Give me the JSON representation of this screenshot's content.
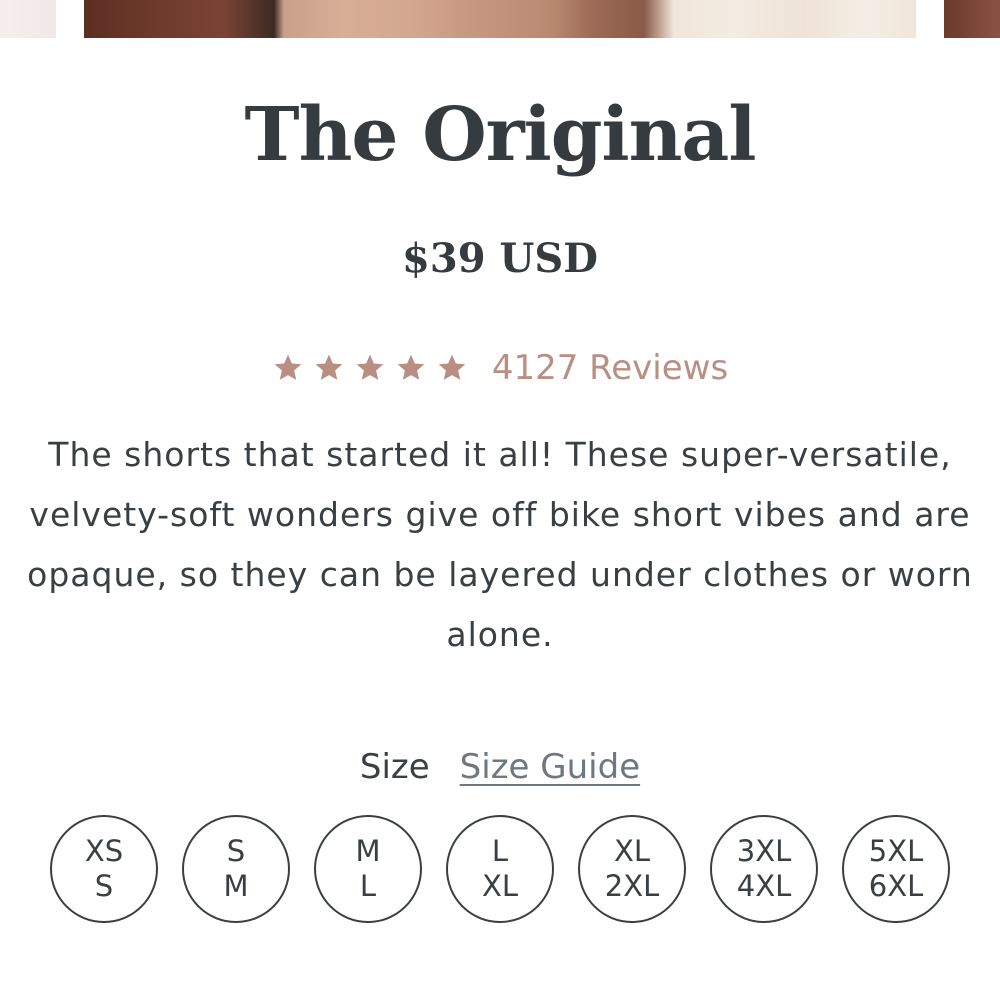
{
  "product": {
    "title": "The Original",
    "price": "$39 USD",
    "rating": {
      "stars": 5,
      "max_stars": 5,
      "star_color": "#b98f84",
      "reviews_label": "4127 Reviews"
    },
    "description": "The shorts that started it all! These super-versatile, velvety-soft wonders give off bike short vibes and are opaque, so they can be layered under clothes or worn alone."
  },
  "size_selector": {
    "label": "Size",
    "guide_link": "Size Guide",
    "options": [
      {
        "line1": "XS",
        "line2": "S"
      },
      {
        "line1": "S",
        "line2": "M"
      },
      {
        "line1": "M",
        "line2": "L"
      },
      {
        "line1": "L",
        "line2": "XL"
      },
      {
        "line1": "XL",
        "line2": "2XL"
      },
      {
        "line1": "3XL",
        "line2": "4XL"
      },
      {
        "line1": "5XL",
        "line2": "6XL"
      }
    ]
  },
  "theme": {
    "text_color": "#353b3f",
    "accent_color": "#b98f84",
    "link_color": "#6e7880"
  }
}
